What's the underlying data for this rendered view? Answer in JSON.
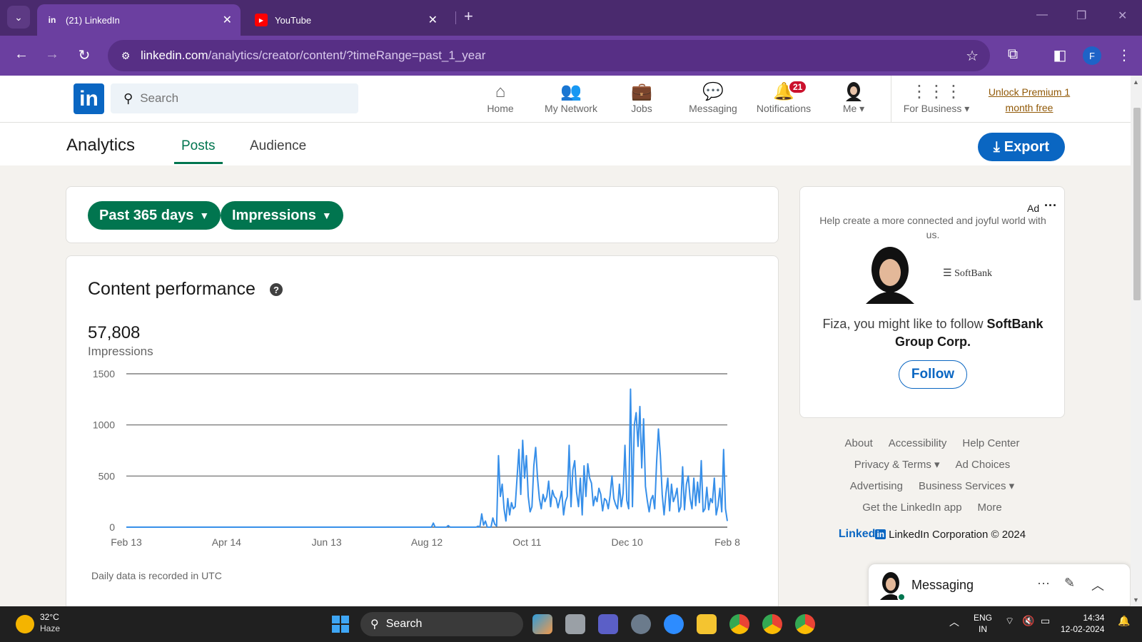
{
  "browser": {
    "tabs": [
      {
        "title": "(21) LinkedIn",
        "favicon": "linkedin-icon",
        "active": true
      },
      {
        "title": "YouTube",
        "favicon": "youtube-icon",
        "active": false
      }
    ],
    "url_host": "linkedin.com",
    "url_path": "/analytics/creator/content/?timeRange=past_1_year",
    "profile_initial": "F"
  },
  "nav": {
    "search_placeholder": "Search",
    "items": [
      {
        "label": "Home",
        "icon": "home-icon"
      },
      {
        "label": "My Network",
        "icon": "network-icon"
      },
      {
        "label": "Jobs",
        "icon": "briefcase-icon"
      },
      {
        "label": "Messaging",
        "icon": "chat-icon"
      },
      {
        "label": "Notifications",
        "icon": "bell-icon",
        "badge": "21"
      },
      {
        "label": "Me",
        "icon": "avatar"
      },
      {
        "label": "For Business",
        "icon": "grid-icon"
      }
    ],
    "premium_line1": "Unlock Premium 1",
    "premium_line2": "month free"
  },
  "subnav": {
    "title": "Analytics",
    "tabs": [
      "Posts",
      "Audience"
    ],
    "export_label": "Export"
  },
  "filters": {
    "range": "Past 365 days",
    "metric": "Impressions"
  },
  "content": {
    "title": "Content performance",
    "value": "57,808",
    "label": "Impressions",
    "footnote": "Daily data is recorded in UTC"
  },
  "chart_data": {
    "type": "line",
    "title": "",
    "xlabel": "",
    "ylabel": "",
    "x_ticks": [
      "Feb 13",
      "Apr 14",
      "Jun 13",
      "Aug 12",
      "Oct 11",
      "Dec 10",
      "Feb 8"
    ],
    "y_ticks": [
      0,
      500,
      1000,
      1500
    ],
    "ylim": [
      0,
      1500
    ],
    "grid": true,
    "color": "#378fe9",
    "series": [
      {
        "values": [
          0,
          0,
          0,
          0,
          0,
          0,
          0,
          0,
          0,
          0,
          0,
          0,
          0,
          0,
          0,
          0,
          0,
          0,
          0,
          0,
          0,
          0,
          0,
          0,
          0,
          0,
          0,
          0,
          0,
          0,
          0,
          0,
          0,
          0,
          0,
          0,
          0,
          0,
          0,
          0,
          0,
          0,
          0,
          0,
          0,
          0,
          0,
          0,
          0,
          0,
          0,
          0,
          0,
          0,
          0,
          0,
          0,
          0,
          0,
          0,
          0,
          0,
          0,
          0,
          0,
          0,
          0,
          0,
          0,
          0,
          0,
          0,
          0,
          0,
          0,
          0,
          0,
          0,
          0,
          0,
          0,
          0,
          0,
          0,
          0,
          0,
          0,
          0,
          0,
          0,
          0,
          0,
          0,
          0,
          0,
          0,
          0,
          0,
          0,
          0,
          0,
          0,
          0,
          0,
          0,
          0,
          0,
          0,
          0,
          0,
          0,
          0,
          0,
          0,
          0,
          0,
          0,
          0,
          0,
          0,
          0,
          0,
          0,
          0,
          0,
          0,
          0,
          0,
          0,
          0,
          0,
          0,
          0,
          0,
          0,
          0,
          0,
          0,
          0,
          0,
          0,
          0,
          0,
          0,
          0,
          0,
          0,
          0,
          0,
          0,
          0,
          0,
          0,
          0,
          0,
          0,
          0,
          0,
          0,
          0,
          0,
          0,
          0,
          0,
          0,
          40,
          0,
          0,
          0,
          0,
          0,
          0,
          0,
          15,
          0,
          0,
          0,
          0,
          0,
          0,
          0,
          0,
          0,
          0,
          0,
          0,
          0,
          0,
          0,
          10,
          0,
          130,
          20,
          60,
          0,
          0,
          0,
          90,
          30,
          10,
          700,
          300,
          420,
          180,
          60,
          280,
          120,
          240,
          180,
          200,
          480,
          760,
          320,
          850,
          480,
          700,
          300,
          150,
          200,
          600,
          780,
          480,
          280,
          180,
          320,
          250,
          300,
          450,
          200,
          360,
          300,
          280,
          190,
          270,
          350,
          120,
          250,
          300,
          800,
          200,
          560,
          650,
          340,
          200,
          480,
          120,
          600,
          300,
          620,
          480,
          430,
          210,
          300,
          250,
          380,
          320,
          160,
          280,
          260,
          180,
          310,
          500,
          280,
          220,
          180,
          420,
          200,
          330,
          800,
          260,
          180,
          1350,
          200,
          1000,
          1120,
          790,
          1180,
          580,
          1060,
          400,
          260,
          150,
          270,
          310,
          180,
          630,
          960,
          700,
          320,
          120,
          330,
          480,
          160,
          420,
          250,
          300,
          380,
          150,
          200,
          590,
          170,
          420,
          500,
          280,
          180,
          480,
          210,
          440,
          240,
          650,
          150,
          180,
          390,
          170,
          280,
          240,
          480,
          120,
          210,
          380,
          150,
          760,
          180,
          60
        ]
      }
    ]
  },
  "ad": {
    "label": "Ad",
    "tagline": "Help create a more connected and joyful world with us.",
    "company_logo_text": "SoftBank",
    "prompt_prefix": "Fiza, you might like to follow ",
    "company": "SoftBank Group Corp.",
    "follow_label": "Follow"
  },
  "footer": {
    "row1": [
      "About",
      "Accessibility",
      "Help Center"
    ],
    "row2": [
      "Privacy & Terms ▾",
      "Ad Choices"
    ],
    "row3": [
      "Advertising",
      "Business Services ▾"
    ],
    "row4": [
      "Get the LinkedIn app",
      "More"
    ],
    "copyright": "LinkedIn Corporation © 2024",
    "brand_word": "Linked",
    "brand_box": "in"
  },
  "messaging": {
    "title": "Messaging"
  },
  "taskbar": {
    "temperature": "32°C",
    "weather": "Haze",
    "search": "Search",
    "lang1": "ENG",
    "lang2": "IN",
    "time": "14:34",
    "date": "12-02-2024"
  }
}
